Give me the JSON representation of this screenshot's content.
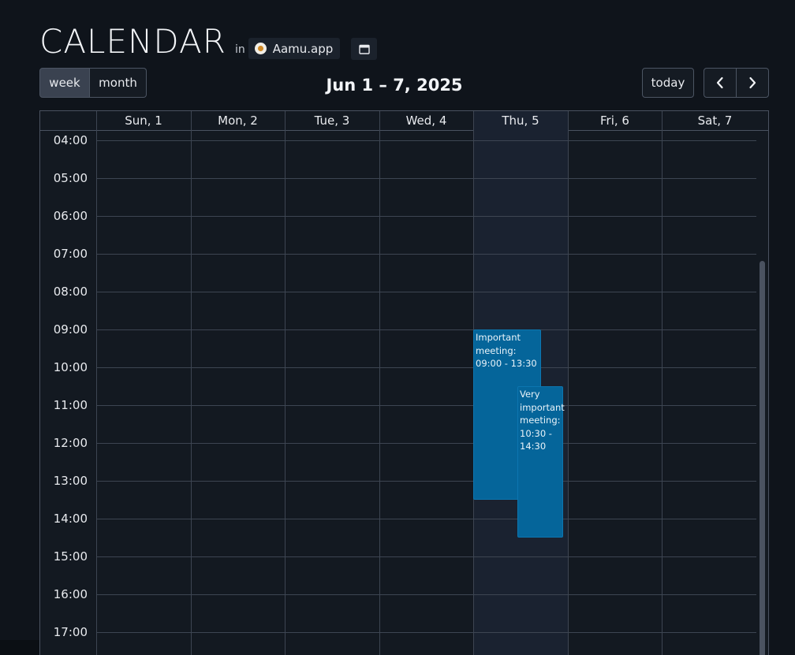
{
  "header": {
    "title": "CALENDAR",
    "in_label": "in",
    "app_name": "Aamu.app"
  },
  "toolbar": {
    "views": [
      "week",
      "month"
    ],
    "active_view": "week",
    "range_title": "Jun 1 – 7, 2025",
    "today_label": "today"
  },
  "icons": {
    "app_logo": "aamu-logo-icon",
    "calendar": "calendar-icon",
    "prev": "chevron-left-icon",
    "next": "chevron-right-icon"
  },
  "days": [
    {
      "label": "Sun, 1",
      "today": false
    },
    {
      "label": "Mon, 2",
      "today": false
    },
    {
      "label": "Tue, 3",
      "today": false
    },
    {
      "label": "Wed, 4",
      "today": false
    },
    {
      "label": "Thu, 5",
      "today": true
    },
    {
      "label": "Fri, 6",
      "today": false
    },
    {
      "label": "Sat, 7",
      "today": false
    }
  ],
  "time_labels": [
    "04:00",
    "05:00",
    "06:00",
    "07:00",
    "08:00",
    "09:00",
    "10:00",
    "11:00",
    "12:00",
    "13:00",
    "14:00",
    "15:00",
    "16:00",
    "17:00"
  ],
  "events": [
    {
      "title": "Important meeting: 09:00 - 13:30",
      "day": 4,
      "start": 9.0,
      "end": 13.5
    },
    {
      "title": "Very important meeting: 10:30 - 14:30",
      "day": 4,
      "start": 10.5,
      "end": 14.5
    }
  ],
  "colors": {
    "background": "#0f141b",
    "today_column": "#1a2230",
    "event": "#05659a",
    "grid_line": "#3d4552"
  }
}
